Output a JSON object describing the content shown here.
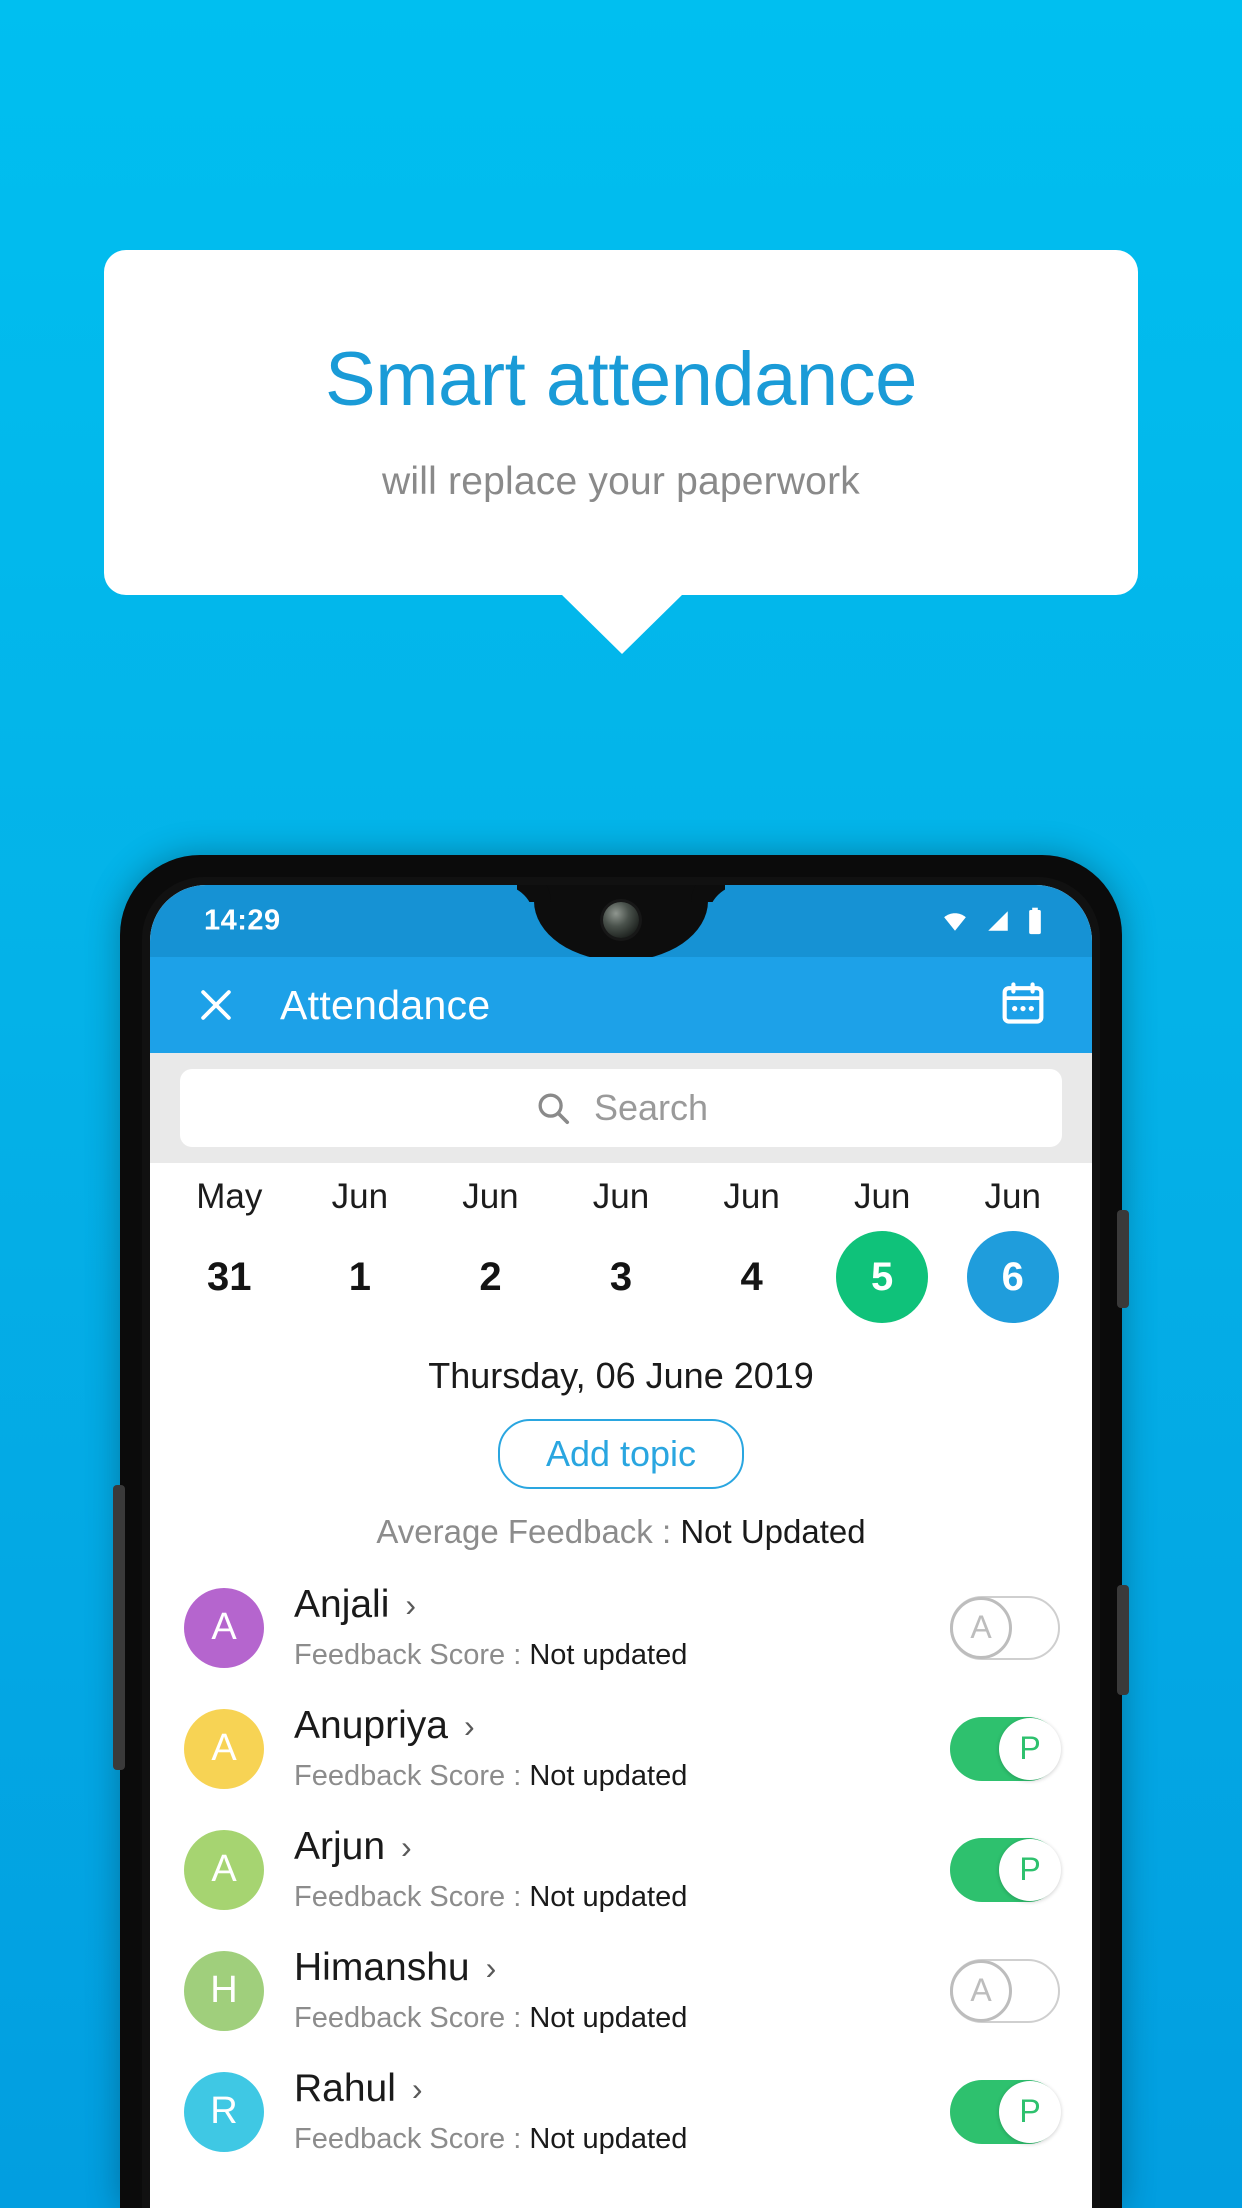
{
  "promo": {
    "title": "Smart attendance",
    "subtitle": "will replace your paperwork",
    "title_color": "#1a9bd7",
    "subtitle_color": "#8a8a8a",
    "background_top": "#00bff0",
    "background_bottom": "#029ee0"
  },
  "phone": {
    "status_bar": {
      "time": "14:29",
      "icons": [
        "wifi-icon",
        "signal-icon",
        "battery-icon"
      ],
      "background": "#1692d4"
    },
    "app_bar": {
      "close_label": "×",
      "title": "Attendance",
      "calendar_icon": "calendar-icon",
      "background": "#1da1e8"
    },
    "search": {
      "placeholder": "Search",
      "icon": "search-icon"
    },
    "date_strip": [
      {
        "month": "May",
        "day": "31",
        "state": "normal"
      },
      {
        "month": "Jun",
        "day": "1",
        "state": "normal"
      },
      {
        "month": "Jun",
        "day": "2",
        "state": "normal"
      },
      {
        "month": "Jun",
        "day": "3",
        "state": "normal"
      },
      {
        "month": "Jun",
        "day": "4",
        "state": "normal"
      },
      {
        "month": "Jun",
        "day": "5",
        "state": "marked"
      },
      {
        "month": "Jun",
        "day": "6",
        "state": "selected"
      }
    ],
    "marked_color": "#0fc27a",
    "selected_color": "#1f9ddc",
    "selected_day_label": "Thursday, 06 June 2019",
    "add_topic_label": "Add topic",
    "average_feedback_label": "Average Feedback : ",
    "average_feedback_value": "Not Updated",
    "feedback_label": "Feedback Score : ",
    "students": [
      {
        "name": "Anjali",
        "initial": "A",
        "avatar_color": "#b565ce",
        "feedback_value": "Not updated",
        "attendance": "A",
        "present": false
      },
      {
        "name": "Anupriya",
        "initial": "A",
        "avatar_color": "#f7d354",
        "feedback_value": "Not updated",
        "attendance": "P",
        "present": true
      },
      {
        "name": "Arjun",
        "initial": "A",
        "avatar_color": "#a6d471",
        "feedback_value": "Not updated",
        "attendance": "P",
        "present": true
      },
      {
        "name": "Himanshu",
        "initial": "H",
        "avatar_color": "#a0cf7c",
        "feedback_value": "Not updated",
        "attendance": "A",
        "present": false
      },
      {
        "name": "Rahul",
        "initial": "R",
        "avatar_color": "#3fc8e4",
        "feedback_value": "Not updated",
        "attendance": "P",
        "present": true
      }
    ]
  }
}
